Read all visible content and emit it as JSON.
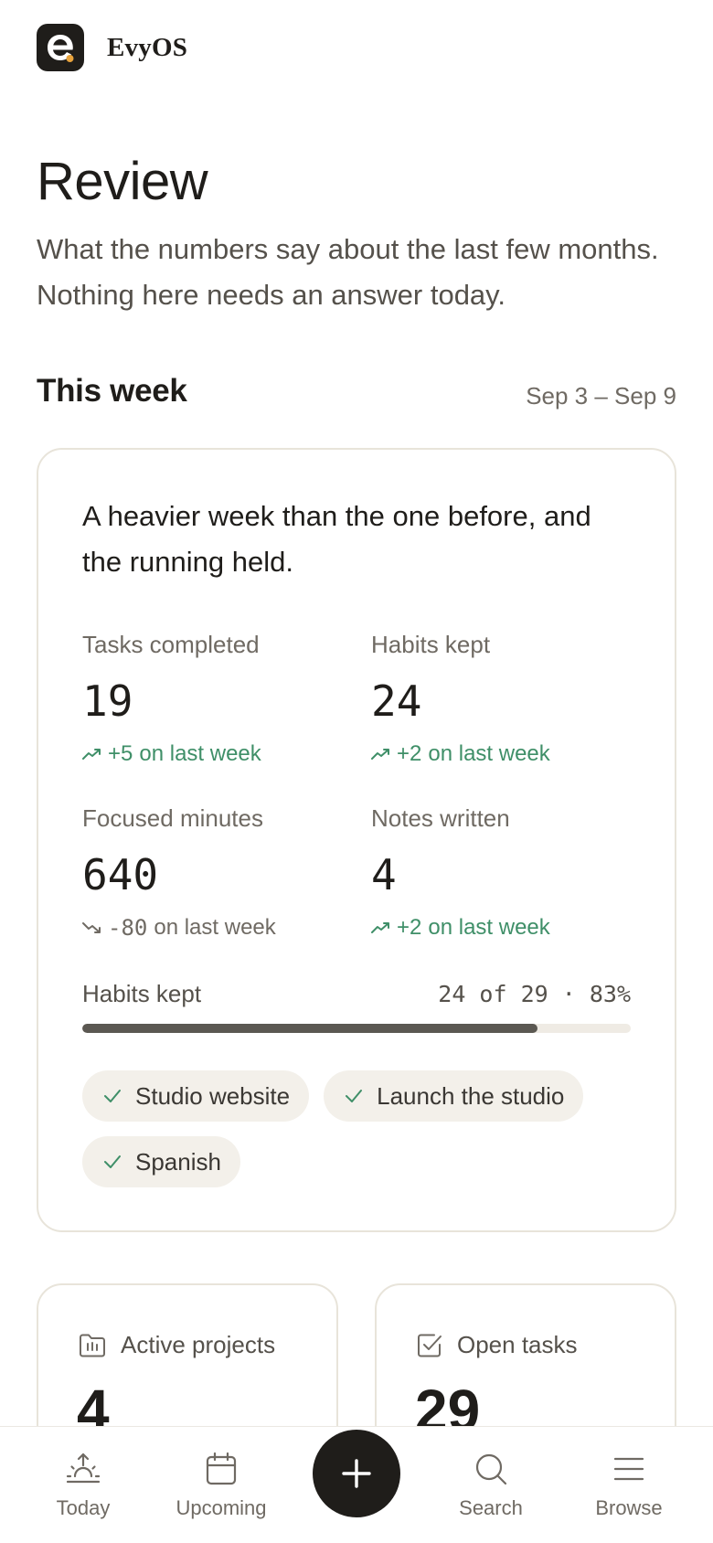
{
  "app": {
    "name": "EvyOS"
  },
  "page": {
    "title": "Review",
    "subtitle": "What the numbers say about the last few months. Nothing here needs an answer today."
  },
  "week": {
    "title": "This week",
    "range": "Sep 3 – Sep 9",
    "summary": "A heavier week than the one before, and the running held.",
    "stats": [
      {
        "label": "Tasks completed",
        "value": "19",
        "delta": "+5",
        "delta_suffix": "on last week",
        "trend": "up"
      },
      {
        "label": "Habits kept",
        "value": "24",
        "delta": "+2",
        "delta_suffix": "on last week",
        "trend": "up"
      },
      {
        "label": "Focused minutes",
        "value": "640",
        "delta": "-80",
        "delta_suffix": "on last week",
        "trend": "down"
      },
      {
        "label": "Notes written",
        "value": "4",
        "delta": "+2",
        "delta_suffix": "on last week",
        "trend": "up"
      }
    ],
    "habits_progress": {
      "label": "Habits kept",
      "value_text": "24 of 29 · 83%",
      "fraction": 0.83
    },
    "chips": [
      "Studio website",
      "Launch the studio",
      "Spanish"
    ]
  },
  "summary_cards": [
    {
      "label": "Active projects",
      "value": "4",
      "icon": "folder-icon"
    },
    {
      "label": "Open tasks",
      "value": "29",
      "icon": "checkbox-icon"
    }
  ],
  "nav": {
    "items": [
      {
        "label": "Today",
        "icon": "sunrise-icon"
      },
      {
        "label": "Upcoming",
        "icon": "calendar-icon"
      },
      {
        "label": "Search",
        "icon": "search-icon"
      },
      {
        "label": "Browse",
        "icon": "menu-icon"
      }
    ],
    "fab_icon": "plus-icon"
  },
  "colors": {
    "accent_dark": "#1f1d1a",
    "positive": "#3f8f68",
    "logo_dot": "#e8a33c",
    "progress_fill": "#5b5852",
    "chip_bg": "#f3f0ea"
  }
}
